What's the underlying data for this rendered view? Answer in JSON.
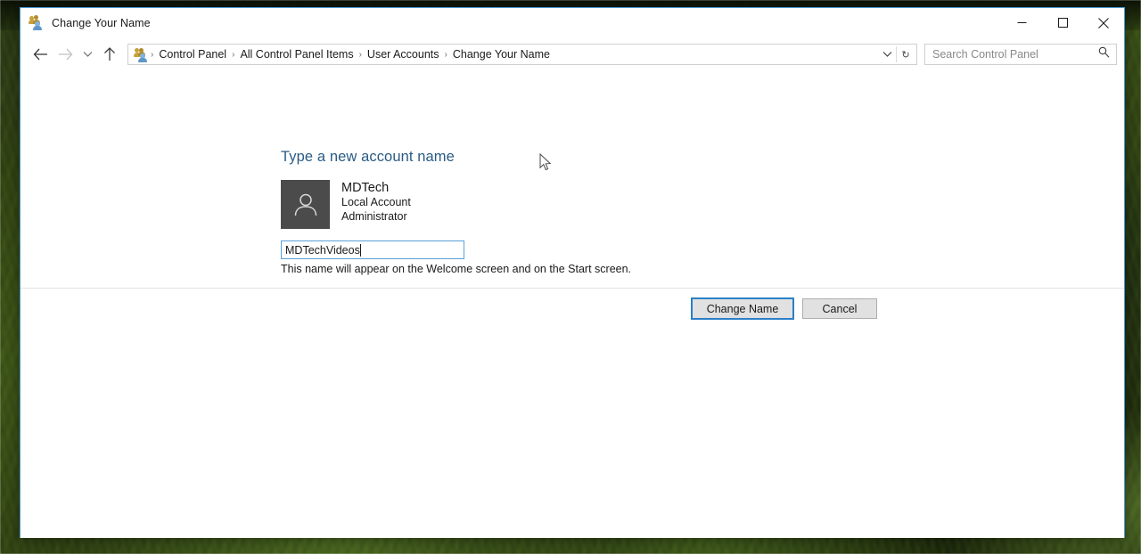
{
  "window": {
    "title": "Change Your Name",
    "app_icon": "user-accounts-icon",
    "controls": {
      "minimize": "–",
      "maximize": "□",
      "close": "✕"
    }
  },
  "nav": {
    "back_icon": "back-arrow-icon",
    "forward_icon": "forward-arrow-icon",
    "recent_icon": "chevron-down-icon",
    "up_icon": "up-arrow-icon",
    "breadcrumbs": [
      "Control Panel",
      "All Control Panel Items",
      "User Accounts",
      "Change Your Name"
    ],
    "separator": "›",
    "address_dropdown_icon": "chevron-down-icon",
    "refresh_icon": "refresh-icon",
    "refresh_glyph": "↻"
  },
  "search": {
    "placeholder": "Search Control Panel",
    "icon": "search-icon"
  },
  "main": {
    "heading": "Type a new account name",
    "account": {
      "avatar_icon": "user-avatar-icon",
      "name": "MDTech",
      "type": "Local Account",
      "role": "Administrator"
    },
    "name_input": {
      "value": "MDTechVideos",
      "placeholder": ""
    },
    "help_text": "This name will appear on the Welcome screen and on the Start screen."
  },
  "actions": {
    "primary": "Change Name",
    "secondary": "Cancel"
  },
  "colors": {
    "accent": "#2a5b84",
    "focus_border": "#5ba0d8",
    "default_button_outline": "#2a80c8",
    "avatar_bg": "#4b4b4b",
    "window_border": "#4b9ad4"
  }
}
